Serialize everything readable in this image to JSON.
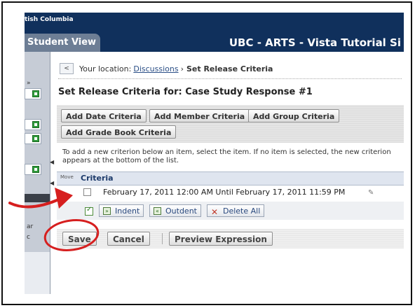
{
  "header": {
    "brand_line": "tish Columbia",
    "tab_label": "Student View",
    "site_title": "UBC - ARTS - Vista Tutorial Si"
  },
  "leftnav": {
    "fragments": [
      "ar",
      "c"
    ]
  },
  "location": {
    "back_icon": "back-icon",
    "prefix": "Your location:",
    "link": "Discussions",
    "separator": "›",
    "current": "Set Release Criteria"
  },
  "page_title": "Set Release Criteria for: Case Study Response #1",
  "criteria_buttons": {
    "add_date": "Add Date Criteria",
    "add_member": "Add Member Criteria",
    "add_group": "Add Group Criteria",
    "add_grade_book": "Add Grade Book Criteria"
  },
  "instructions": "To add a new criterion below an item, select the item. If no item is selected, the new criterion appears at the bottom of the list.",
  "criteria_list": {
    "move_label": "Move",
    "header_label": "Criteria",
    "items": [
      {
        "text": "February 17, 2011 12:00 AM Until February 17, 2011 11:59 PM"
      }
    ]
  },
  "toolbar": {
    "indent": "Indent",
    "outdent": "Outdent",
    "delete_all": "Delete All"
  },
  "actions": {
    "save": "Save",
    "cancel": "Cancel",
    "preview": "Preview Expression"
  },
  "colors": {
    "header_bg": "#10305c",
    "tab_bg": "#6d7e95",
    "annotation_red": "#d61f1f"
  }
}
